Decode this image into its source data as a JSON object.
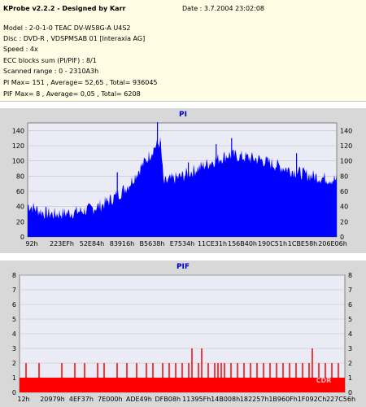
{
  "header": {
    "title": "KProbe v2.2.2 - Designed by Karr",
    "date": "Date : 3.7.2004 23:02:08",
    "model": "Model : 2-0-1-0 TEAC    DV-W58G-A        U4S2",
    "disc": "Disc : DVD-R , VDSPMSAB 01 [Interaxia AG]",
    "speed": "Speed : 4x",
    "ecc": "ECC blocks sum (PI/PIF) : 8/1",
    "range": "Scanned range : 0 - 2310A3h",
    "pi": "PI Max= 151 , Average= 52,65 , Total= 936045",
    "pif": "PIF Max= 8 , Average= 0,05 , Total= 6208"
  },
  "watermark": "CDR",
  "colors": {
    "pi_fill": "#0000ff",
    "pif_fill": "#ff0000",
    "title": "#0000c8",
    "plot_bg": "#ebebf6",
    "panel_bg": "#d8d8d8",
    "info_bg": "#fffde3"
  },
  "chart_data": [
    {
      "type": "area",
      "title": "PI",
      "ylim": [
        0,
        150
      ],
      "yticks": [
        "0",
        "20",
        "40",
        "60",
        "80",
        "100",
        "120",
        "140"
      ],
      "ytick_values": [
        0,
        20,
        40,
        60,
        80,
        100,
        120,
        140
      ],
      "xticks": [
        "92h",
        "223EFh",
        "52E84h",
        "83916h",
        "B5638h",
        "E7534h",
        "11CE31h",
        "156B40h",
        "190C51h",
        "1CBE58h",
        "206E06h"
      ],
      "xlim_hex": "0 - 2310A3h",
      "series": [
        {
          "x_fraction": [
            0,
            0.02,
            0.05,
            0.08,
            0.12,
            0.16,
            0.2,
            0.24,
            0.28,
            0.3,
            0.33,
            0.36,
            0.39,
            0.41,
            0.43,
            0.44,
            0.46,
            0.5,
            0.55,
            0.6,
            0.65,
            0.7,
            0.75,
            0.8,
            0.85,
            0.9,
            0.95,
            1
          ],
          "values": [
            42,
            38,
            32,
            30,
            31,
            33,
            36,
            42,
            52,
            58,
            70,
            88,
            105,
            118,
            125,
            70,
            75,
            80,
            90,
            100,
            108,
            105,
            102,
            95,
            88,
            82,
            78,
            75
          ],
          "spikes": [
            [
              0.42,
              151
            ],
            [
              0.43,
              125
            ],
            [
              0.66,
              130
            ],
            [
              0.87,
              110
            ],
            [
              0.29,
              85
            ],
            [
              0.37,
              82
            ],
            [
              0.52,
              98
            ],
            [
              0.61,
              122
            ]
          ]
        }
      ]
    },
    {
      "type": "bar",
      "title": "PIF",
      "ylim": [
        0,
        8
      ],
      "yticks": [
        "0",
        "1",
        "2",
        "3",
        "4",
        "5",
        "6",
        "7",
        "8"
      ],
      "ytick_values": [
        0,
        1,
        2,
        3,
        4,
        5,
        6,
        7,
        8
      ],
      "xticks": [
        "12h",
        "20979h",
        "4EF37h",
        "7E000h",
        "ADE49h",
        "DFB08h",
        "11395Fh",
        "14B008h",
        "182257h",
        "1B960Fh",
        "1F092Ch",
        "227C56h"
      ],
      "series": [
        {
          "baseline": 1,
          "spikes": [
            [
              0.02,
              2
            ],
            [
              0.06,
              2
            ],
            [
              0.09,
              1
            ],
            [
              0.13,
              2
            ],
            [
              0.17,
              2
            ],
            [
              0.2,
              2
            ],
            [
              0.24,
              2
            ],
            [
              0.26,
              2
            ],
            [
              0.3,
              2
            ],
            [
              0.33,
              2
            ],
            [
              0.36,
              2
            ],
            [
              0.39,
              2
            ],
            [
              0.41,
              2
            ],
            [
              0.44,
              2
            ],
            [
              0.46,
              2
            ],
            [
              0.48,
              2
            ],
            [
              0.5,
              2
            ],
            [
              0.52,
              2
            ],
            [
              0.53,
              3
            ],
            [
              0.55,
              2
            ],
            [
              0.56,
              3
            ],
            [
              0.58,
              2
            ],
            [
              0.6,
              2
            ],
            [
              0.61,
              2
            ],
            [
              0.62,
              2
            ],
            [
              0.63,
              2
            ],
            [
              0.65,
              2
            ],
            [
              0.67,
              2
            ],
            [
              0.69,
              2
            ],
            [
              0.71,
              2
            ],
            [
              0.73,
              2
            ],
            [
              0.75,
              2
            ],
            [
              0.77,
              2
            ],
            [
              0.79,
              2
            ],
            [
              0.81,
              2
            ],
            [
              0.83,
              2
            ],
            [
              0.85,
              2
            ],
            [
              0.87,
              2
            ],
            [
              0.89,
              2
            ],
            [
              0.9,
              3
            ],
            [
              0.92,
              2
            ],
            [
              0.94,
              2
            ],
            [
              0.96,
              2
            ],
            [
              0.98,
              2
            ]
          ]
        }
      ]
    }
  ]
}
